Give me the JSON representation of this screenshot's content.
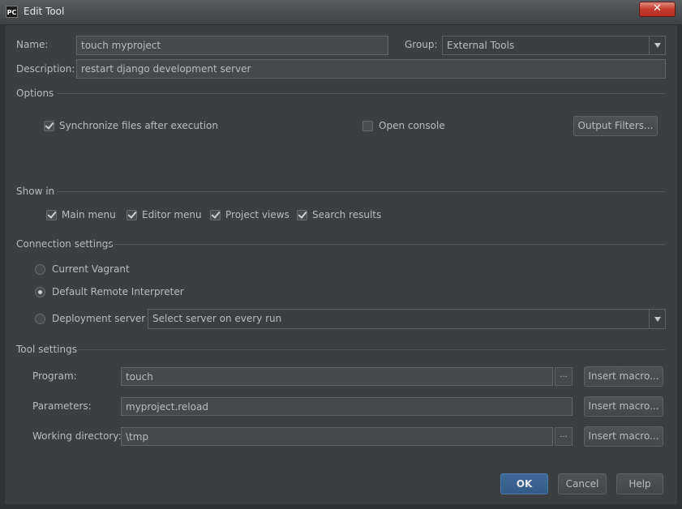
{
  "window": {
    "title": "Edit Tool",
    "app_icon": "PC",
    "close_glyph": "✕"
  },
  "form": {
    "name_label": "Name:",
    "name_value": "touch myproject",
    "group_label": "Group:",
    "group_value": "External Tools",
    "description_label": "Description:",
    "description_value": "restart django development server"
  },
  "options": {
    "title": "Options",
    "sync_label": "Synchronize files after execution",
    "sync_checked": true,
    "console_label": "Open console",
    "console_checked": false,
    "output_filters_label": "Output Filters..."
  },
  "show_in": {
    "title": "Show in",
    "items": [
      {
        "label": "Main menu",
        "checked": true
      },
      {
        "label": "Editor menu",
        "checked": true
      },
      {
        "label": "Project views",
        "checked": true
      },
      {
        "label": "Search results",
        "checked": true
      }
    ]
  },
  "connection": {
    "title": "Connection settings",
    "vagrant_label": "Current Vagrant",
    "default_interp_label": "Default Remote Interpreter",
    "deployment_label": "Deployment server",
    "deployment_select": "Select server on every run",
    "selected": "default_interp"
  },
  "tool": {
    "title": "Tool settings",
    "program_label": "Program:",
    "program_value": "touch",
    "parameters_label": "Parameters:",
    "parameters_value": "myproject.reload",
    "workdir_label": "Working directory:",
    "workdir_value": "\\tmp",
    "browse_label": "...",
    "insert_macro_label": "Insert macro..."
  },
  "buttons": {
    "ok": "OK",
    "cancel": "Cancel",
    "help": "Help"
  },
  "colors": {
    "background": "#3c3f41",
    "field": "#45494a",
    "primary": "#365880",
    "close": "#c43b2c"
  }
}
